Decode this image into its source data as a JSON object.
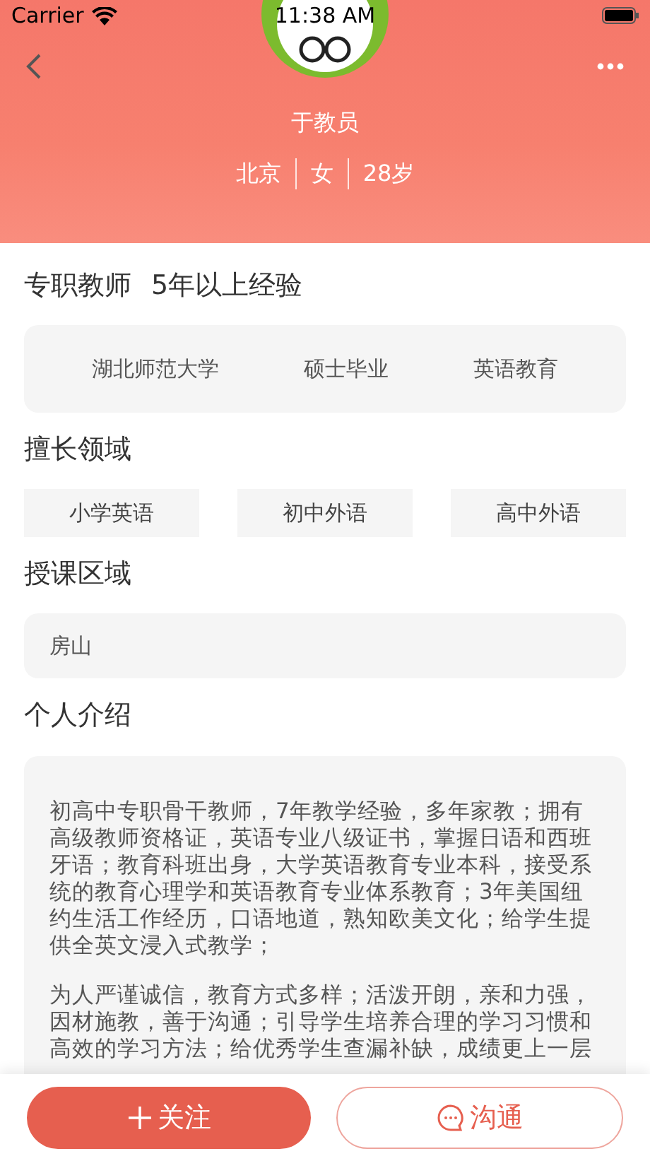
{
  "status_bar": {
    "carrier": "Carrier",
    "time": "11:38 AM"
  },
  "profile": {
    "name": "于教员",
    "meta": [
      "北京",
      "女",
      "28岁"
    ]
  },
  "headline": {
    "role": "专职教师",
    "experience": "5年以上经验"
  },
  "education": [
    "湖北师范大学",
    "硕士毕业",
    "英语教育"
  ],
  "sections": [
    {
      "kind": "tags",
      "title": "擅长领域",
      "items": [
        "小学英语",
        "初中外语",
        "高中外语"
      ]
    },
    {
      "kind": "text",
      "title": "授课区域",
      "text": "房山"
    },
    {
      "kind": "paragraphs",
      "title": "个人介绍",
      "paragraphs": [
        "初高中专职骨干教师，7年教学经验，多年家教；拥有高级教师资格证，英语专业八级证书，掌握日语和西班牙语；教育科班出身，大学英语教育专业本科，接受系统的教育心理学和英语教育专业体系教育；3年美国纽约生活工作经历，口语地道，熟知欧美文化；给学生提供全英文浸入式教学；",
        "为人严谨诚信，教育方式多样；活泼开朗，亲和力强，因材施教，善于沟通；引导学生培养合理的学习习惯和高效的学习方法；给优秀学生查漏补缺，成绩更上一层"
      ]
    }
  ],
  "actions": [
    {
      "kind": "follow",
      "label": "关注"
    },
    {
      "kind": "chat",
      "label": "沟通"
    }
  ]
}
